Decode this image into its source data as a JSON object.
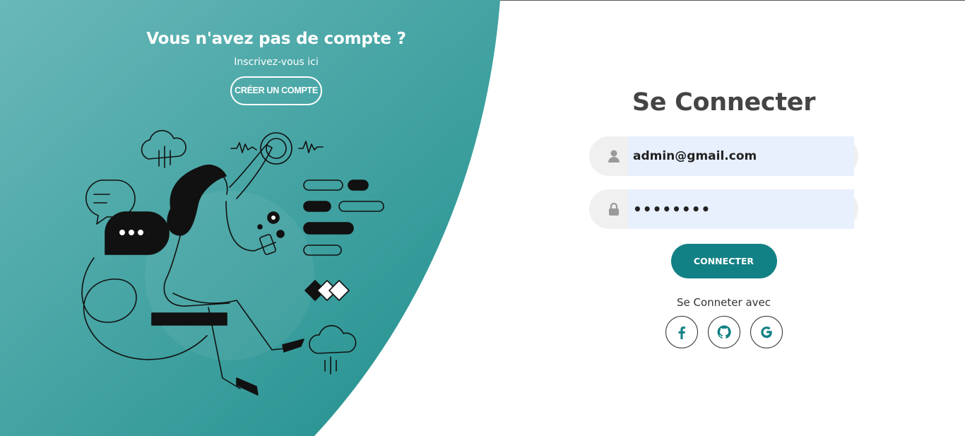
{
  "colors": {
    "accent": "#128185",
    "panel_light": "#66b7b8",
    "panel_dark": "#1f8f8d",
    "field_bg": "#f0f0f0",
    "autofill_bg": "#e8f0fe",
    "title_color": "#444444"
  },
  "panel": {
    "title": "Vous n'avez pas de compte ?",
    "subtitle": "Inscrivez-vous ici",
    "create_button": "CRÉER UN COMPTE",
    "illustration_icon": "person-using-phone-illustration"
  },
  "login": {
    "title": "Se Connecter",
    "email": {
      "value": "admin@gmail.com",
      "icon": "user-icon"
    },
    "password": {
      "value": "••••••••",
      "icon": "lock-icon"
    },
    "submit": "CONNECTER",
    "social_label": "Se Conneter avec",
    "social": [
      {
        "name": "facebook",
        "icon": "facebook-icon"
      },
      {
        "name": "github",
        "icon": "github-icon"
      },
      {
        "name": "google",
        "icon": "google-icon"
      }
    ]
  }
}
